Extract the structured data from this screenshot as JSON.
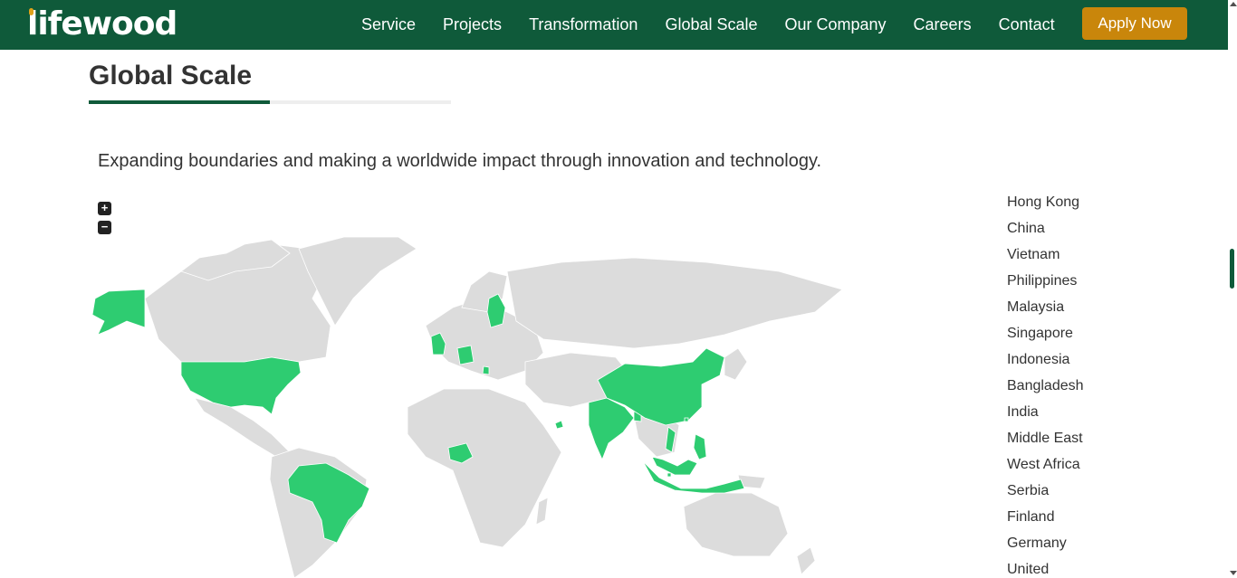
{
  "brand": {
    "name": "lifewood"
  },
  "nav": {
    "items": [
      "Service",
      "Projects",
      "Transformation",
      "Global Scale",
      "Our Company",
      "Careers",
      "Contact"
    ],
    "cta": "Apply Now"
  },
  "section": {
    "title": "Global Scale",
    "subtitle": "Expanding boundaries and making a worldwide impact through innovation and technology."
  },
  "map": {
    "zoom_in": "+",
    "zoom_out": "−",
    "highlight_color": "#2ecc71",
    "land_color": "#dcdcdc"
  },
  "countries": [
    "Hong Kong",
    "China",
    "Vietnam",
    "Philippines",
    "Malaysia",
    "Singapore",
    "Indonesia",
    "Bangladesh",
    "India",
    "Middle East",
    "West Africa",
    "Serbia",
    "Finland",
    "Germany",
    "United"
  ],
  "colors": {
    "header_bg": "#0f5a3a",
    "accent": "#c9860b",
    "brand_dot": "#e0a21a"
  }
}
